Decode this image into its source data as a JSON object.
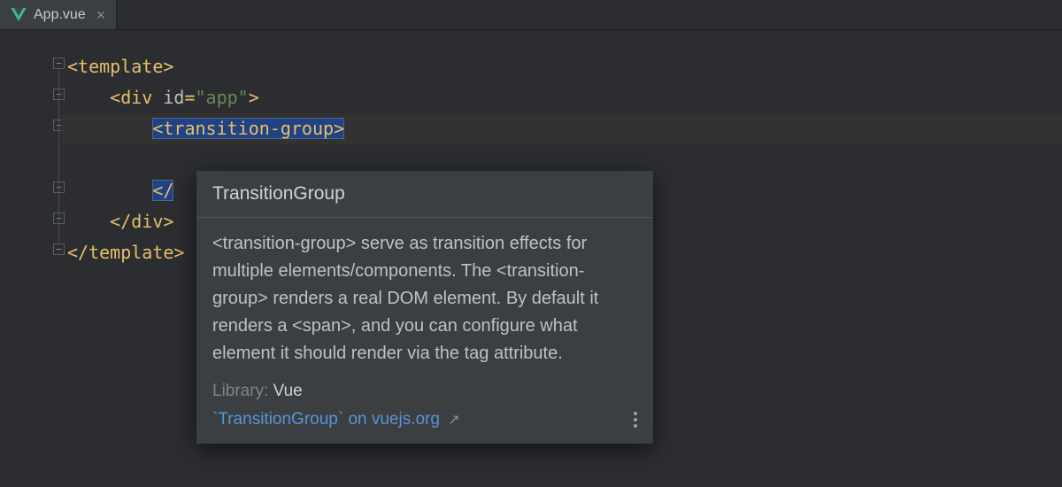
{
  "tab": {
    "filename": "App.vue"
  },
  "code": {
    "l1_open": "<template>",
    "l2_open_a": "<div",
    "l2_attr": " id",
    "l2_eq": "=",
    "l2_val": "\"app\"",
    "l2_open_b": ">",
    "l3_tag": "<transition-group>",
    "l5_partial": "</",
    "l6_close": "</div>",
    "l7_close": "</template>"
  },
  "doc": {
    "title": "TransitionGroup",
    "body": "<transition-group> serve as transition effects for multiple elements/components. The <transition-group> renders a real DOM element. By default it renders a <span>, and you can configure what element it should render via the tag attribute.",
    "library_label": "Library:",
    "library_value": "Vue",
    "link_text": "`TransitionGroup` on vuejs.org"
  }
}
